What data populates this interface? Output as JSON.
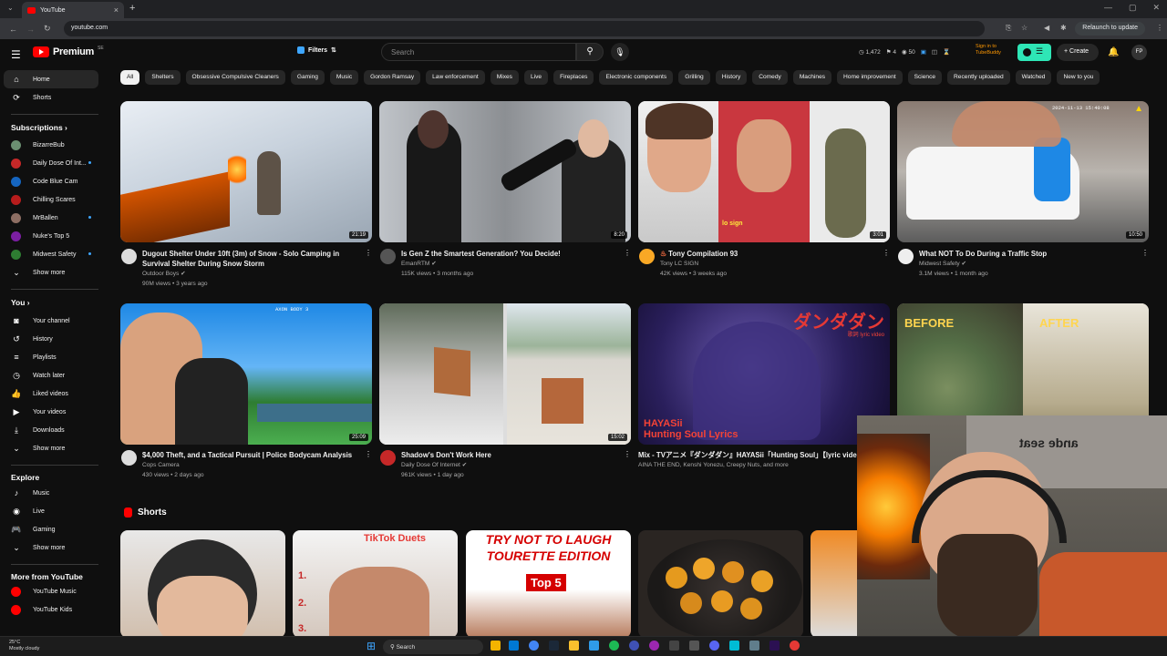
{
  "browser": {
    "tab_title": "YouTube",
    "url": "youtube.com",
    "relaunch_label": "Relaunch to update"
  },
  "header": {
    "logo_text": "Premium",
    "logo_country": "SE",
    "filters_label": "Filters",
    "search_placeholder": "Search",
    "stats": [
      "1,472",
      "4",
      "50"
    ],
    "tubebuddy_text": "Sign in to TubeBuddy",
    "create_label": "Create",
    "user_initials": "FP"
  },
  "sidebar": {
    "main": [
      {
        "label": "Home",
        "icon": "home-icon"
      },
      {
        "label": "Shorts",
        "icon": "shorts-icon"
      }
    ],
    "subscriptions_title": "Subscriptions",
    "subscriptions": [
      {
        "label": "BizarreBub",
        "color": "#6b8f71"
      },
      {
        "label": "Daily Dose Of Int...",
        "color": "#c62828"
      },
      {
        "label": "Code Blue Cam",
        "color": "#1565c0"
      },
      {
        "label": "Chilling Scares",
        "color": "#b71c1c"
      },
      {
        "label": "MrBallen",
        "color": "#8d6e63"
      },
      {
        "label": "Nuke's Top 5",
        "color": "#7b1fa2"
      },
      {
        "label": "Midwest Safety",
        "color": "#2e7d32"
      }
    ],
    "show_more": "Show more",
    "you_title": "You",
    "you_items": [
      {
        "label": "Your channel",
        "icon": "user-icon"
      },
      {
        "label": "History",
        "icon": "history-icon"
      },
      {
        "label": "Playlists",
        "icon": "playlist-icon"
      },
      {
        "label": "Watch later",
        "icon": "clock-icon"
      },
      {
        "label": "Liked videos",
        "icon": "like-icon"
      },
      {
        "label": "Your videos",
        "icon": "video-icon"
      },
      {
        "label": "Downloads",
        "icon": "download-icon"
      }
    ],
    "explore_title": "Explore",
    "explore_items": [
      {
        "label": "Music",
        "icon": "music-icon"
      },
      {
        "label": "Live",
        "icon": "live-icon"
      },
      {
        "label": "Gaming",
        "icon": "gaming-icon"
      }
    ],
    "more_title": "More from YouTube",
    "more_items": [
      {
        "label": "YouTube Music"
      },
      {
        "label": "YouTube Kids"
      }
    ]
  },
  "chips": [
    "All",
    "Shelters",
    "Obsessive Compulsive Cleaners",
    "Gaming",
    "Music",
    "Gordon Ramsay",
    "Law enforcement",
    "Mixes",
    "Live",
    "Fireplaces",
    "Electronic components",
    "Grilling",
    "History",
    "Comedy",
    "Machines",
    "Home improvement",
    "Science",
    "Recently uploaded",
    "Watched",
    "New to you"
  ],
  "videos": [
    {
      "title": "Dugout Shelter Under 10ft (3m) of Snow - Solo Camping in Survival Shelter During Snow Storm",
      "channel": "Outdoor Boys",
      "meta": "90M views • 3 years ago",
      "duration": "21:19"
    },
    {
      "title": "Is Gen Z the Smartest Generation? You Decide!",
      "channel": "EmanRTM",
      "meta": "115K views • 3 months ago",
      "duration": "8:20"
    },
    {
      "title": "Tony Compilation 93",
      "channel": "Tony LC SIGN",
      "meta": "42K views • 3 weeks ago",
      "duration": "3:01"
    },
    {
      "title": "What NOT To Do During a Traffic Stop",
      "channel": "Midwest Safety",
      "meta": "3.1M views • 1 month ago",
      "duration": "10:50"
    },
    {
      "title": "$4,000 Theft, and a Tactical Pursuit | Police Bodycam Analysis",
      "channel": "Cops Camera",
      "meta": "430 views • 2 days ago",
      "duration": "25:09"
    },
    {
      "title": "Shadow's Don't Work Here",
      "channel": "Daily Dose Of Internet",
      "meta": "961K views • 1 day ago",
      "duration": "15:02"
    },
    {
      "title": "Mix - TVアニメ『ダンダダン』HAYASii「Hunting Soul」【lyric vide",
      "channel": "AINA THE END, Kenshi Yonezu, Creepy Nuts, and more",
      "meta": "",
      "duration": ""
    }
  ],
  "thumb_texts": {
    "tony_caption": "lo sign",
    "bodycam_stamp": "2024-11-13 15:40:08",
    "anime_title": "HAYASii\nHunting Soul Lyrics",
    "anime_jp": "ダンダダン",
    "anime_sub": "歌詞 lyric video",
    "before": "BEFORE",
    "after": "AFTER"
  },
  "shorts": {
    "title": "Shorts",
    "s2_text": "TikTok Duets",
    "s3_line1": "TRY NOT TO LAUGH",
    "s3_line2": "TOURETTE EDITION",
    "s3_line3": "Top 5"
  },
  "webcam": {
    "shirt_text": "ande seat"
  },
  "taskbar": {
    "temp": "25°C",
    "weather": "Mostly cloudy",
    "search_label": "Search"
  }
}
